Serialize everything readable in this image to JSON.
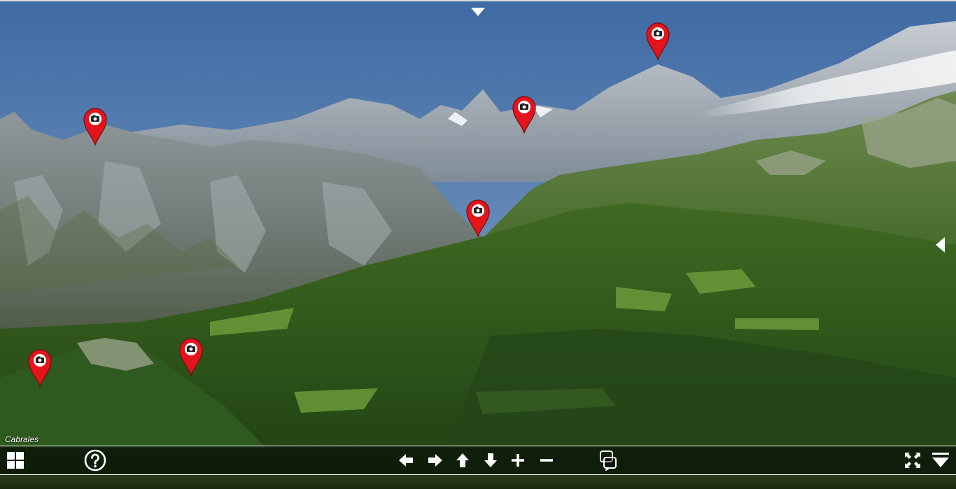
{
  "viewer": {
    "caption": "Cabrales",
    "accent_color": "#e3141b",
    "hotspots": [
      {
        "icon": "camera-icon"
      },
      {
        "icon": "camera-icon"
      },
      {
        "icon": "camera-icon"
      },
      {
        "icon": "camera-icon"
      },
      {
        "icon": "camera-icon"
      },
      {
        "icon": "camera-icon"
      }
    ]
  },
  "toolbar": {
    "buttons": [
      {
        "name": "thumbnails-button",
        "icon": "grid-icon"
      },
      {
        "name": "help-button",
        "icon": "question-icon"
      },
      {
        "name": "pan-left-button",
        "icon": "arrow-left-icon"
      },
      {
        "name": "pan-right-button",
        "icon": "arrow-right-icon"
      },
      {
        "name": "pan-up-button",
        "icon": "arrow-up-icon"
      },
      {
        "name": "pan-down-button",
        "icon": "arrow-down-icon"
      },
      {
        "name": "zoom-in-button",
        "icon": "plus-icon"
      },
      {
        "name": "zoom-out-button",
        "icon": "minus-icon"
      },
      {
        "name": "hotspots-toggle-button",
        "icon": "hotspot-toggle-icon"
      },
      {
        "name": "fullscreen-button",
        "icon": "fullscreen-icon"
      },
      {
        "name": "hide-toolbar-button",
        "icon": "collapse-down-icon"
      }
    ]
  }
}
